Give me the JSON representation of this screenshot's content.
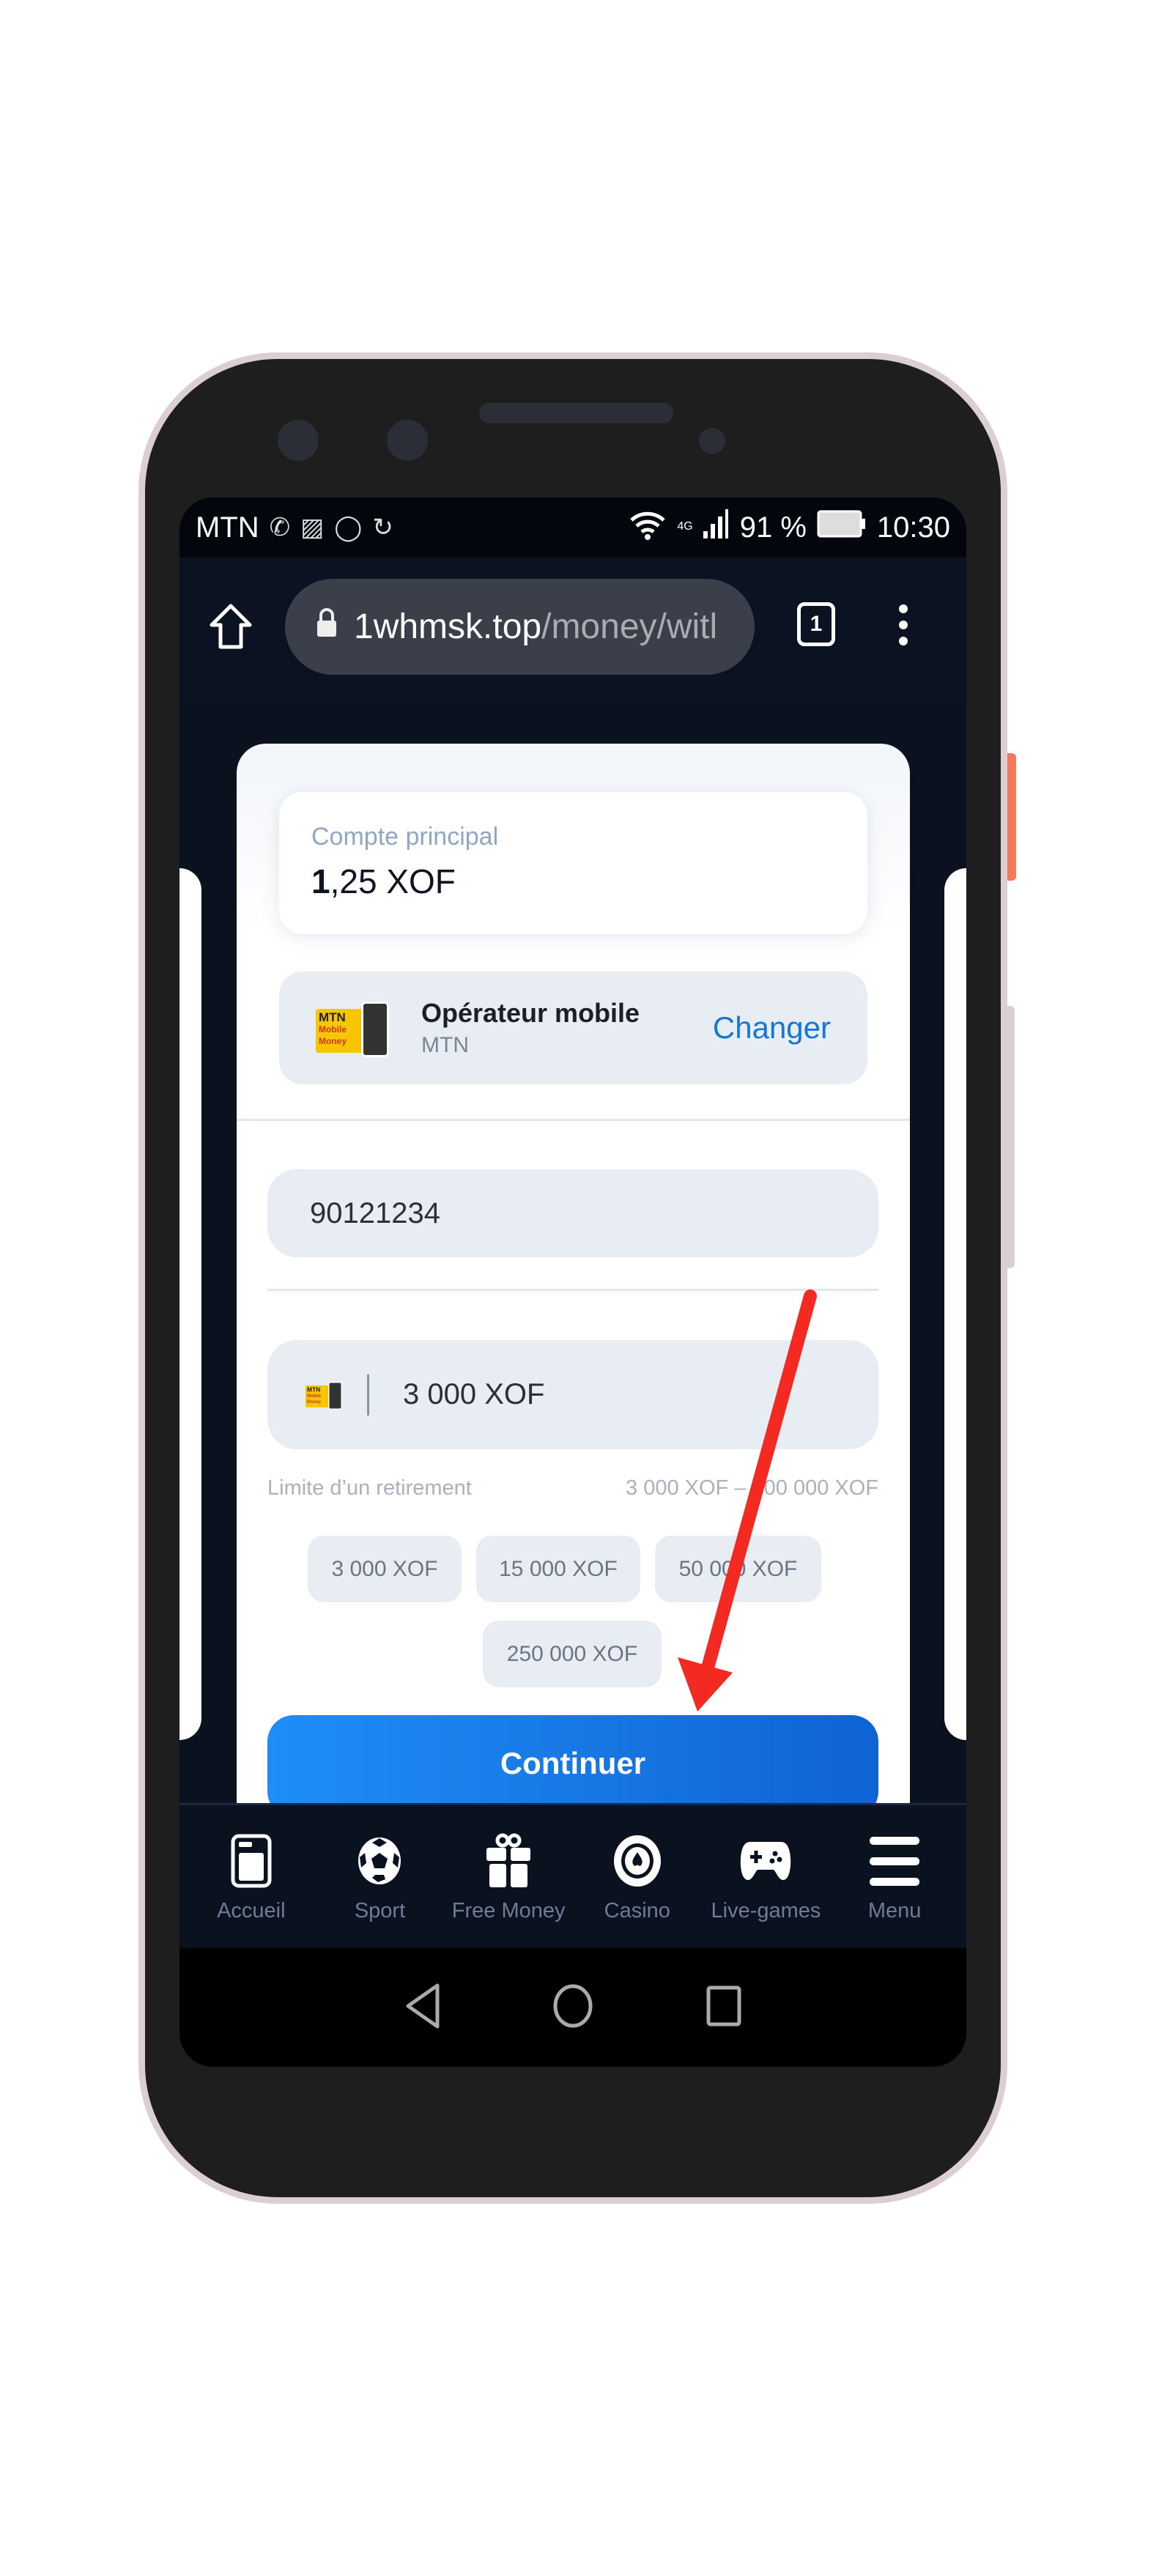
{
  "status_bar": {
    "carrier": "MTN",
    "network": "4G",
    "battery": "91 %",
    "time": "10:30"
  },
  "browser": {
    "url_domain": "1whmsk.top",
    "url_path": "/money/witl",
    "tab_count": "1"
  },
  "balance": {
    "label": "Compte principal",
    "value_integer": "1",
    "value_rest": ",25 XOF"
  },
  "operator": {
    "title": "Opérateur mobile",
    "name": "MTN",
    "change_label": "Changer",
    "logo_text": "MTN Mobile Money"
  },
  "phone_input": {
    "value": "90121234"
  },
  "amount_input": {
    "value": "3 000 XOF"
  },
  "limit": {
    "label": "Limite d’un retirement",
    "range": "3 000 XOF – 300 000 XOF"
  },
  "chips": [
    "3 000 XOF",
    "15 000 XOF",
    "50 000 XOF",
    "250 000 XOF"
  ],
  "continue_label": "Continuer",
  "bottom_nav": [
    {
      "label": "Accueil",
      "icon": "home-card-icon"
    },
    {
      "label": "Sport",
      "icon": "soccer-ball-icon"
    },
    {
      "label": "Free Money",
      "icon": "gift-icon"
    },
    {
      "label": "Casino",
      "icon": "casino-chip-icon"
    },
    {
      "label": "Live-games",
      "icon": "gamepad-icon"
    },
    {
      "label": "Menu",
      "icon": "hamburger-icon"
    }
  ],
  "colors": {
    "accent": "#1477d6",
    "button": "#1f8ef8",
    "annotation_arrow": "#f22a22",
    "page_bg": "#0a1220"
  }
}
